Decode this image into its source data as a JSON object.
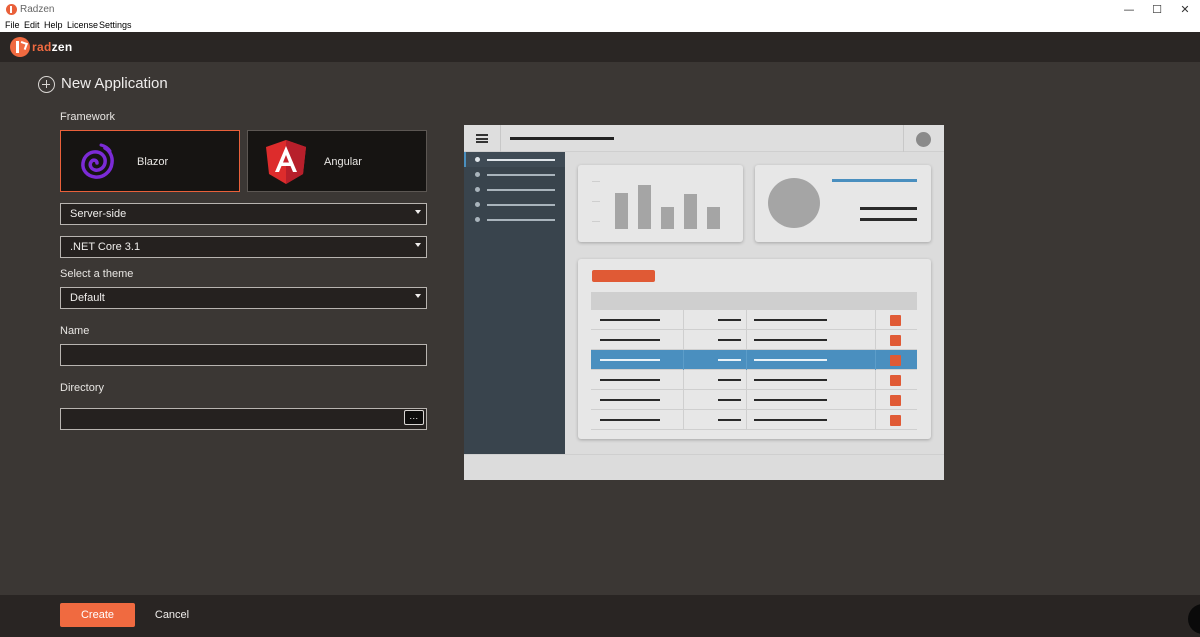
{
  "window": {
    "title": "Radzen"
  },
  "menu": [
    "File",
    "Edit",
    "Help",
    "License",
    "Settings"
  ],
  "brand": {
    "name_part1": "rad",
    "name_part2": "zen",
    "accent": "#f06a40"
  },
  "page": {
    "title": "New Application"
  },
  "framework": {
    "label": "Framework",
    "options": [
      {
        "name": "Blazor",
        "icon": "blazor-logo-icon",
        "selected": true
      },
      {
        "name": "Angular",
        "icon": "angular-logo-icon",
        "selected": false
      }
    ]
  },
  "hosting": {
    "value": "Server-side"
  },
  "runtime": {
    "value": ".NET Core 3.1"
  },
  "theme": {
    "label": "Select a theme",
    "value": "Default"
  },
  "name_field": {
    "label": "Name",
    "value": ""
  },
  "directory_field": {
    "label": "Directory",
    "value": "",
    "browse_label": "..."
  },
  "footer": {
    "create_label": "Create",
    "cancel_label": "Cancel"
  },
  "colors": {
    "accent": "#f06a40",
    "selected_border": "#e9603a",
    "preview_blue": "#4a8fbf"
  },
  "preview": {
    "sidebar_items": 5,
    "chart_bars": [
      0.45,
      0.55,
      0.28,
      0.44,
      0.28
    ],
    "table_rows": 6,
    "selected_row": 3
  }
}
